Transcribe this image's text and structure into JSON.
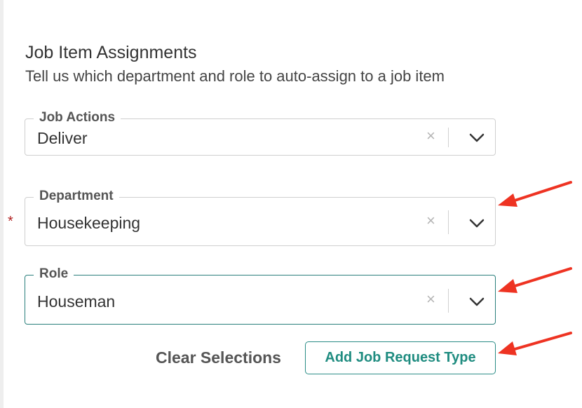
{
  "section": {
    "title": "Job Item Assignments",
    "subtitle": "Tell us which department and role to auto-assign to a job item"
  },
  "fields": {
    "job_actions": {
      "label": "Job Actions",
      "value": "Deliver",
      "clear_icon": "×"
    },
    "department": {
      "label": "Department",
      "value": "Housekeeping",
      "required_mark": "*",
      "clear_icon": "×"
    },
    "role": {
      "label": "Role",
      "value": "Houseman",
      "clear_icon": "×"
    }
  },
  "actions": {
    "clear_label": "Clear Selections",
    "add_label": "Add Job Request Type"
  },
  "colors": {
    "accent": "#1f8c80",
    "focus_border": "#2a7f7c",
    "required": "#b22222",
    "annotation_arrow": "#ee3322"
  },
  "icons": [
    "clear-icon",
    "chevron-down-icon",
    "annotation-arrow"
  ]
}
